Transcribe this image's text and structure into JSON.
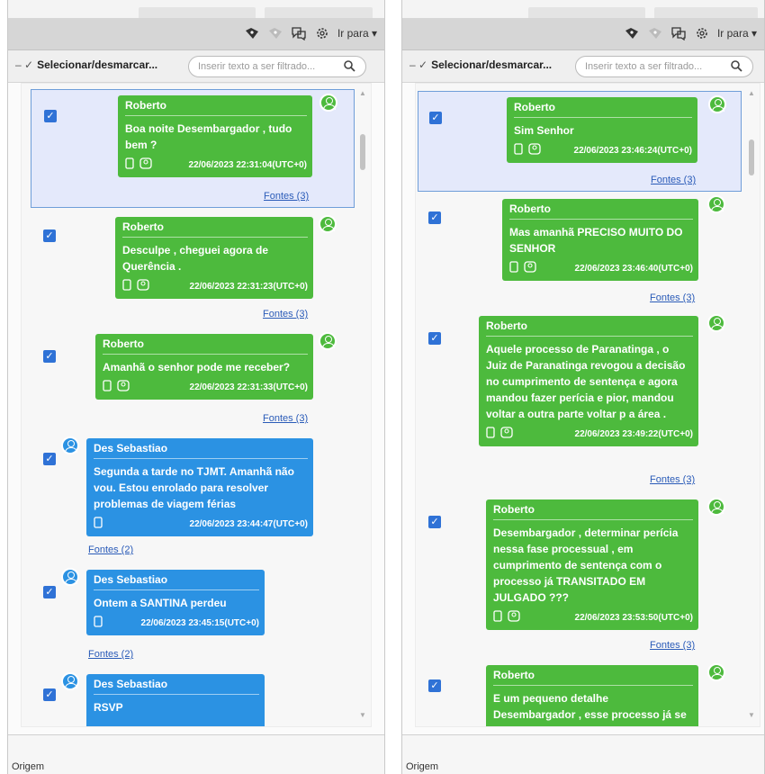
{
  "left": {
    "toolbar": {
      "goto_label": "Ir para"
    },
    "filter": {
      "select_label": "Selecionar/desmarcar...",
      "placeholder": "Inserir texto a ser filtrado..."
    },
    "messages": [
      {
        "sender": "Roberto",
        "text": "Boa noite Desembargador , tudo bem ?",
        "timestamp": "22/06/2023 22:31:04(UTC+0)",
        "sources": "Fontes (3)",
        "checked": true,
        "selected": true,
        "color": "#4dba3d"
      },
      {
        "sender": "Roberto",
        "text": "Desculpe , cheguei agora de Querência .",
        "timestamp": "22/06/2023 22:31:23(UTC+0)",
        "sources": "Fontes (3)",
        "checked": true,
        "color": "#4dba3d"
      },
      {
        "sender": "Roberto",
        "text": "Amanhã o senhor pode me receber?",
        "timestamp": "22/06/2023 22:31:33(UTC+0)",
        "sources": "Fontes (3)",
        "checked": true,
        "color": "#4dba3d"
      },
      {
        "sender": "Des Sebastiao",
        "text": "Segunda a tarde no TJMT. Amanhã não vou. Estou enrolado para resolver problemas de viagem férias",
        "timestamp": "22/06/2023 23:44:47(UTC+0)",
        "sources": "Fontes (2)",
        "checked": true,
        "color": "#2b92e3"
      },
      {
        "sender": "Des Sebastiao",
        "text": "Ontem a SANTINA perdeu",
        "timestamp": "22/06/2023 23:45:15(UTC+0)",
        "sources": "Fontes (2)",
        "checked": true,
        "color": "#2b92e3"
      },
      {
        "sender": "Des Sebastiao",
        "text": "RSVP",
        "checked": true,
        "color": "#2b92e3"
      }
    ],
    "footer": "Origem"
  },
  "right": {
    "toolbar": {
      "goto_label": "Ir para"
    },
    "filter": {
      "select_label": "Selecionar/desmarcar...",
      "placeholder": "Inserir texto a ser filtrado..."
    },
    "messages": [
      {
        "sender": "Roberto",
        "text": "Sim Senhor",
        "timestamp": "22/06/2023 23:46:24(UTC+0)",
        "sources": "Fontes (3)",
        "checked": true,
        "selected": true,
        "color": "#4dba3d"
      },
      {
        "sender": "Roberto",
        "text": "Mas amanhã PRECISO MUITO DO SENHOR",
        "timestamp": "22/06/2023 23:46:40(UTC+0)",
        "sources": "Fontes (3)",
        "checked": true,
        "color": "#4dba3d"
      },
      {
        "sender": "Roberto",
        "text": "Aquele processo de Paranatinga , o Juiz de Paranatinga revogou a decisão no cumprimento de sentença e agora mandou fazer perícia e pior, mandou voltar a outra parte voltar p a área .",
        "timestamp": "22/06/2023 23:49:22(UTC+0)",
        "sources": "Fontes (3)",
        "checked": true,
        "color": "#4dba3d"
      },
      {
        "sender": "Roberto",
        "text": "Desembargador , determinar perícia nessa fase processual , em cumprimento de sentença com o processo já TRANSITADO EM JULGADO ???",
        "timestamp": "22/06/2023 23:53:50(UTC+0)",
        "sources": "Fontes (3)",
        "checked": true,
        "color": "#4dba3d"
      },
      {
        "sender": "Roberto",
        "text": "E um pequeno detalhe Desembargador , esse processo já se",
        "checked": true,
        "color": "#4dba3d"
      }
    ],
    "footer": "Origem"
  }
}
